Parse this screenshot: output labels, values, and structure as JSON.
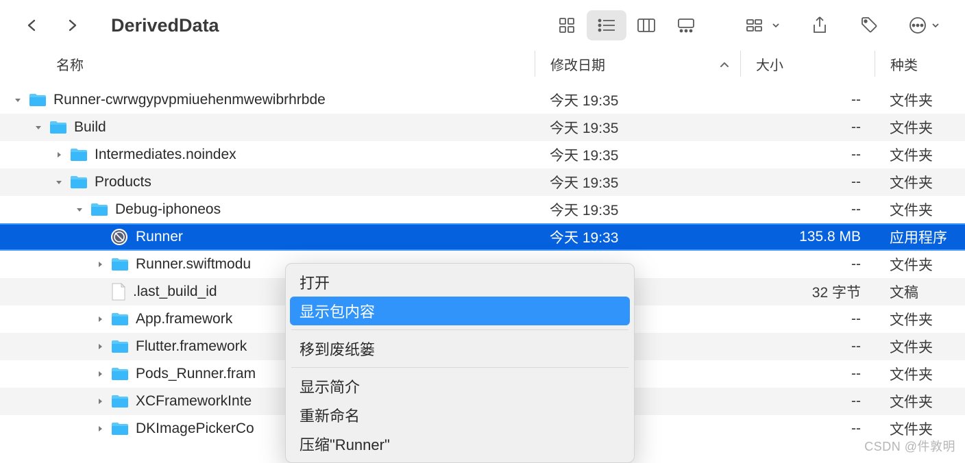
{
  "toolbar": {
    "title": "DerivedData"
  },
  "columns": {
    "name": "名称",
    "date": "修改日期",
    "size": "大小",
    "kind": "种类"
  },
  "rows": [
    {
      "indent": 0,
      "disclosure": "down",
      "icon": "folder",
      "name": "Runner-cwrwgypvpmiuehenmwewibrhrbde",
      "date": "今天 19:35",
      "size": "--",
      "kind": "文件夹",
      "alt": false
    },
    {
      "indent": 1,
      "disclosure": "down",
      "icon": "folder",
      "name": "Build",
      "date": "今天 19:35",
      "size": "--",
      "kind": "文件夹",
      "alt": true
    },
    {
      "indent": 2,
      "disclosure": "right",
      "icon": "folder",
      "name": "Intermediates.noindex",
      "date": "今天 19:35",
      "size": "--",
      "kind": "文件夹",
      "alt": false
    },
    {
      "indent": 2,
      "disclosure": "down",
      "icon": "folder",
      "name": "Products",
      "date": "今天 19:35",
      "size": "--",
      "kind": "文件夹",
      "alt": true
    },
    {
      "indent": 3,
      "disclosure": "down",
      "icon": "folder",
      "name": "Debug-iphoneos",
      "date": "今天 19:35",
      "size": "--",
      "kind": "文件夹",
      "alt": false
    },
    {
      "indent": 4,
      "disclosure": "none",
      "icon": "app",
      "name": "Runner",
      "date": "今天 19:33",
      "size": "135.8 MB",
      "kind": "应用程序",
      "selected": true
    },
    {
      "indent": 4,
      "disclosure": "right",
      "icon": "folder",
      "name": "Runner.swiftmodu",
      "date": "",
      "size": "--",
      "kind": "文件夹",
      "alt": false
    },
    {
      "indent": 4,
      "disclosure": "none",
      "icon": "file",
      "name": ".last_build_id",
      "date": "",
      "size": "32 字节",
      "kind": "文稿",
      "alt": true
    },
    {
      "indent": 4,
      "disclosure": "right",
      "icon": "folder",
      "name": "App.framework",
      "date": "",
      "size": "--",
      "kind": "文件夹",
      "alt": false
    },
    {
      "indent": 4,
      "disclosure": "right",
      "icon": "folder",
      "name": "Flutter.framework",
      "date": "",
      "size": "--",
      "kind": "文件夹",
      "alt": true
    },
    {
      "indent": 4,
      "disclosure": "right",
      "icon": "folder",
      "name": "Pods_Runner.fram",
      "date": "",
      "size": "--",
      "kind": "文件夹",
      "alt": false
    },
    {
      "indent": 4,
      "disclosure": "right",
      "icon": "folder",
      "name": "XCFrameworkInte",
      "date": "",
      "size": "--",
      "kind": "文件夹",
      "alt": true
    },
    {
      "indent": 4,
      "disclosure": "right",
      "icon": "folder",
      "name": "DKImagePickerCo",
      "date": "",
      "size": "--",
      "kind": "文件夹",
      "alt": false
    }
  ],
  "context_menu": {
    "items": [
      {
        "label": "打开",
        "highlighted": false
      },
      {
        "label": "显示包内容",
        "highlighted": true
      },
      {
        "sep": true
      },
      {
        "label": "移到废纸篓",
        "highlighted": false
      },
      {
        "sep": true
      },
      {
        "label": "显示简介",
        "highlighted": false
      },
      {
        "label": "重新命名",
        "highlighted": false
      },
      {
        "label": "压缩\"Runner\"",
        "highlighted": false
      }
    ]
  },
  "watermark": "CSDN @件敦明"
}
